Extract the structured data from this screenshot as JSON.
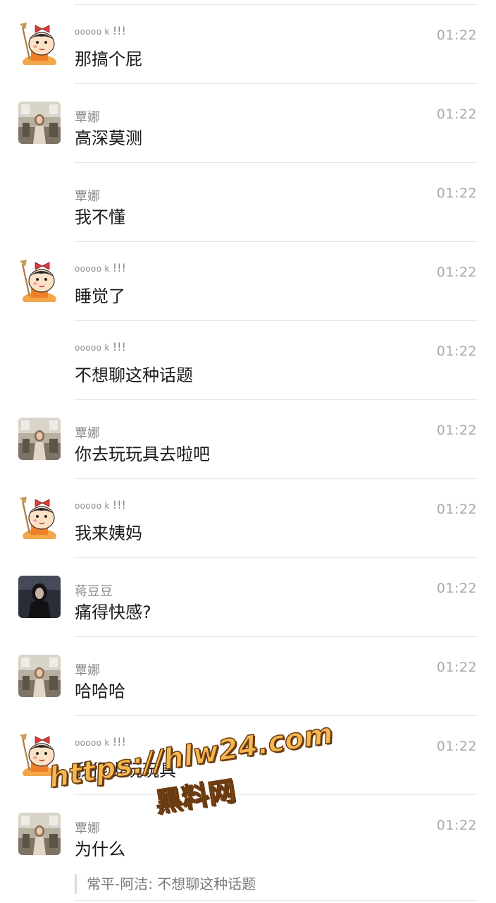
{
  "messages": [
    {
      "sender": "ooooo k",
      "sender_suffix": "!!!",
      "time": "01:22",
      "text": "那搞个屁",
      "avatar": "cartoon"
    },
    {
      "sender": "覃娜",
      "time": "01:22",
      "text": "高深莫测",
      "avatar": "photo-room"
    },
    {
      "sender": "覃娜",
      "time": "01:22",
      "text": "我不懂",
      "avatar": "none"
    },
    {
      "sender": "ooooo k",
      "sender_suffix": "!!!",
      "time": "01:22",
      "text": "睡觉了",
      "avatar": "cartoon"
    },
    {
      "sender": "ooooo k",
      "sender_suffix": "!!!",
      "time": "01:22",
      "text": "不想聊这种话题",
      "avatar": "none"
    },
    {
      "sender": "覃娜",
      "time": "01:22",
      "text": "你去玩玩具去啦吧",
      "avatar": "photo-room"
    },
    {
      "sender": "ooooo k",
      "sender_suffix": "!!!",
      "time": "01:22",
      "text": "我来姨妈",
      "avatar": "cartoon"
    },
    {
      "sender": "蒋豆豆",
      "time": "01:22",
      "text": "痛得快感?",
      "avatar": "photo-dark"
    },
    {
      "sender": "覃娜",
      "time": "01:22",
      "text": "哈哈哈",
      "avatar": "photo-room"
    },
    {
      "sender": "ooooo k",
      "sender_suffix": "!!!",
      "time": "01:22",
      "text": "我很少玩玩具",
      "avatar": "cartoon"
    },
    {
      "sender": "覃娜",
      "time": "01:22",
      "text": "为什么",
      "avatar": "photo-room",
      "quote": "常平-阿洁: 不想聊这种话题"
    }
  ],
  "watermark": {
    "url": "https://hlw24.com",
    "name": "黑料网"
  },
  "colors": {
    "divider": "#e7e7e7",
    "time": "#a9a9a9",
    "sender": "#8b8b8b",
    "watermark": "#f6b74f"
  }
}
